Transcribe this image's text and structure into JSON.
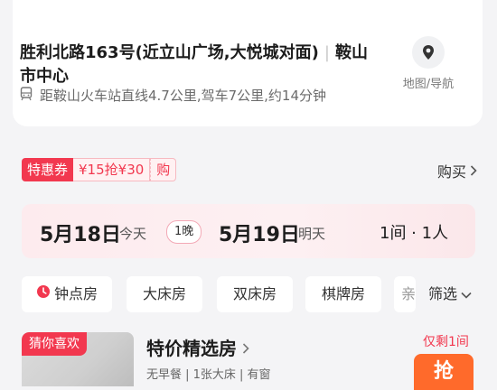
{
  "hotel": {
    "address_line": "胜利北路163号(近立山广场,大悦城对面)",
    "address_sep": "|",
    "address_area": "鞍山市中心",
    "map_label": "地图/导航",
    "distance": "距鞍山火车站直线4.7公里,驾车7公里,约14分钟"
  },
  "coupon": {
    "tag": "特惠券",
    "price": "¥15抢¥30",
    "buy_small": "购",
    "buy_link": "购买"
  },
  "dates": {
    "checkin": "5月18日",
    "checkin_sub": "今天",
    "nights": "1晚",
    "checkout": "5月19日",
    "checkout_sub": "明天",
    "rooms_guests": "1间 · 1人"
  },
  "filters": {
    "chips": [
      "钟点房",
      "大床房",
      "双床房",
      "棋牌房",
      "亲"
    ],
    "filter_label": "筛选"
  },
  "room": {
    "badge": "猜你喜欢",
    "title": "特价精选房",
    "subtitle": "无早餐 | 1张大床 | 有窗",
    "remaining": "仅剩1间",
    "grab": "抢"
  },
  "colors": {
    "accent": "#f2384f",
    "orange": "#ff6a2b"
  }
}
